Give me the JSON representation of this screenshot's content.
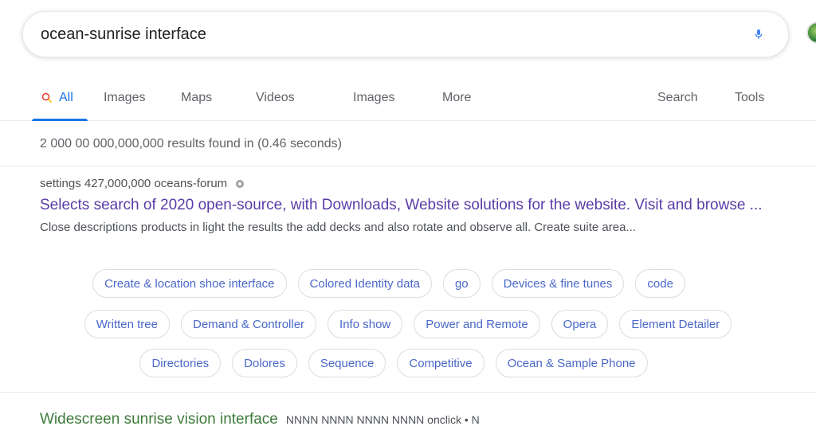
{
  "search": {
    "query": "ocean-sunrise interface"
  },
  "tabs": [
    {
      "label": "All"
    },
    {
      "label": "Images"
    },
    {
      "label": "Maps"
    },
    {
      "label": "Videos"
    },
    {
      "label": "Images"
    },
    {
      "label": "More"
    },
    {
      "label": "Search"
    },
    {
      "label": "Tools"
    }
  ],
  "stats": {
    "text": "2 000 00 000,000,000 results found in (0.46 seconds)"
  },
  "result": {
    "cite": "settings 427,000,000 oceans-forum",
    "title": "Selects search of 2020 open-source, with Downloads, Website solutions for the website. Visit and browse ...",
    "snippet": "Close descriptions products in light the results the add decks and also rotate and observe all. Create suite area..."
  },
  "chips": [
    [
      "Create & location shoe interface",
      "Colored Identity data",
      "go",
      "Devices & fine tunes",
      "code"
    ],
    [
      "Written tree",
      "Demand & Controller",
      "Info show",
      "Power and Remote",
      "Opera",
      "Element Detailer"
    ],
    [
      "Directories",
      "Dolores",
      "Sequence",
      "Competitive",
      "Ocean & Sample Phone"
    ]
  ],
  "next_result": {
    "title": "Widescreen sunrise vision interface",
    "url": "NNNN NNNN NNNN NNNN onclick • N"
  },
  "colors": {
    "accent": "#1a73e8",
    "visited_link": "#5b3ca8",
    "chip_text": "#4a68c8"
  }
}
